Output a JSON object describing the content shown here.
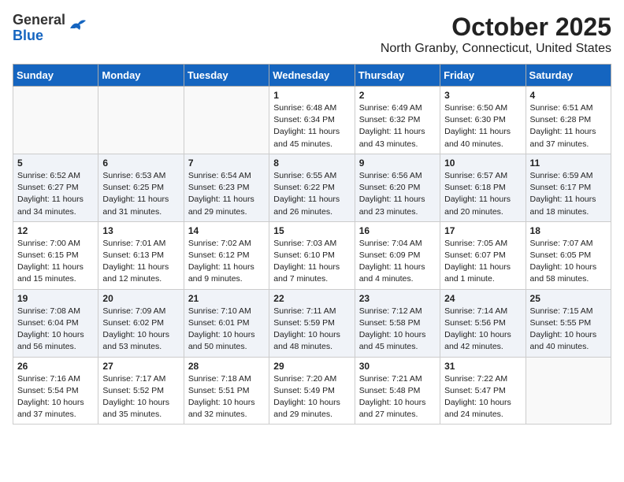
{
  "logo": {
    "general": "General",
    "blue": "Blue"
  },
  "header": {
    "month": "October 2025",
    "location": "North Granby, Connecticut, United States"
  },
  "weekdays": [
    "Sunday",
    "Monday",
    "Tuesday",
    "Wednesday",
    "Thursday",
    "Friday",
    "Saturday"
  ],
  "weeks": [
    [
      {
        "day": "",
        "info": ""
      },
      {
        "day": "",
        "info": ""
      },
      {
        "day": "",
        "info": ""
      },
      {
        "day": "1",
        "info": "Sunrise: 6:48 AM\nSunset: 6:34 PM\nDaylight: 11 hours and 45 minutes."
      },
      {
        "day": "2",
        "info": "Sunrise: 6:49 AM\nSunset: 6:32 PM\nDaylight: 11 hours and 43 minutes."
      },
      {
        "day": "3",
        "info": "Sunrise: 6:50 AM\nSunset: 6:30 PM\nDaylight: 11 hours and 40 minutes."
      },
      {
        "day": "4",
        "info": "Sunrise: 6:51 AM\nSunset: 6:28 PM\nDaylight: 11 hours and 37 minutes."
      }
    ],
    [
      {
        "day": "5",
        "info": "Sunrise: 6:52 AM\nSunset: 6:27 PM\nDaylight: 11 hours and 34 minutes."
      },
      {
        "day": "6",
        "info": "Sunrise: 6:53 AM\nSunset: 6:25 PM\nDaylight: 11 hours and 31 minutes."
      },
      {
        "day": "7",
        "info": "Sunrise: 6:54 AM\nSunset: 6:23 PM\nDaylight: 11 hours and 29 minutes."
      },
      {
        "day": "8",
        "info": "Sunrise: 6:55 AM\nSunset: 6:22 PM\nDaylight: 11 hours and 26 minutes."
      },
      {
        "day": "9",
        "info": "Sunrise: 6:56 AM\nSunset: 6:20 PM\nDaylight: 11 hours and 23 minutes."
      },
      {
        "day": "10",
        "info": "Sunrise: 6:57 AM\nSunset: 6:18 PM\nDaylight: 11 hours and 20 minutes."
      },
      {
        "day": "11",
        "info": "Sunrise: 6:59 AM\nSunset: 6:17 PM\nDaylight: 11 hours and 18 minutes."
      }
    ],
    [
      {
        "day": "12",
        "info": "Sunrise: 7:00 AM\nSunset: 6:15 PM\nDaylight: 11 hours and 15 minutes."
      },
      {
        "day": "13",
        "info": "Sunrise: 7:01 AM\nSunset: 6:13 PM\nDaylight: 11 hours and 12 minutes."
      },
      {
        "day": "14",
        "info": "Sunrise: 7:02 AM\nSunset: 6:12 PM\nDaylight: 11 hours and 9 minutes."
      },
      {
        "day": "15",
        "info": "Sunrise: 7:03 AM\nSunset: 6:10 PM\nDaylight: 11 hours and 7 minutes."
      },
      {
        "day": "16",
        "info": "Sunrise: 7:04 AM\nSunset: 6:09 PM\nDaylight: 11 hours and 4 minutes."
      },
      {
        "day": "17",
        "info": "Sunrise: 7:05 AM\nSunset: 6:07 PM\nDaylight: 11 hours and 1 minute."
      },
      {
        "day": "18",
        "info": "Sunrise: 7:07 AM\nSunset: 6:05 PM\nDaylight: 10 hours and 58 minutes."
      }
    ],
    [
      {
        "day": "19",
        "info": "Sunrise: 7:08 AM\nSunset: 6:04 PM\nDaylight: 10 hours and 56 minutes."
      },
      {
        "day": "20",
        "info": "Sunrise: 7:09 AM\nSunset: 6:02 PM\nDaylight: 10 hours and 53 minutes."
      },
      {
        "day": "21",
        "info": "Sunrise: 7:10 AM\nSunset: 6:01 PM\nDaylight: 10 hours and 50 minutes."
      },
      {
        "day": "22",
        "info": "Sunrise: 7:11 AM\nSunset: 5:59 PM\nDaylight: 10 hours and 48 minutes."
      },
      {
        "day": "23",
        "info": "Sunrise: 7:12 AM\nSunset: 5:58 PM\nDaylight: 10 hours and 45 minutes."
      },
      {
        "day": "24",
        "info": "Sunrise: 7:14 AM\nSunset: 5:56 PM\nDaylight: 10 hours and 42 minutes."
      },
      {
        "day": "25",
        "info": "Sunrise: 7:15 AM\nSunset: 5:55 PM\nDaylight: 10 hours and 40 minutes."
      }
    ],
    [
      {
        "day": "26",
        "info": "Sunrise: 7:16 AM\nSunset: 5:54 PM\nDaylight: 10 hours and 37 minutes."
      },
      {
        "day": "27",
        "info": "Sunrise: 7:17 AM\nSunset: 5:52 PM\nDaylight: 10 hours and 35 minutes."
      },
      {
        "day": "28",
        "info": "Sunrise: 7:18 AM\nSunset: 5:51 PM\nDaylight: 10 hours and 32 minutes."
      },
      {
        "day": "29",
        "info": "Sunrise: 7:20 AM\nSunset: 5:49 PM\nDaylight: 10 hours and 29 minutes."
      },
      {
        "day": "30",
        "info": "Sunrise: 7:21 AM\nSunset: 5:48 PM\nDaylight: 10 hours and 27 minutes."
      },
      {
        "day": "31",
        "info": "Sunrise: 7:22 AM\nSunset: 5:47 PM\nDaylight: 10 hours and 24 minutes."
      },
      {
        "day": "",
        "info": ""
      }
    ]
  ]
}
